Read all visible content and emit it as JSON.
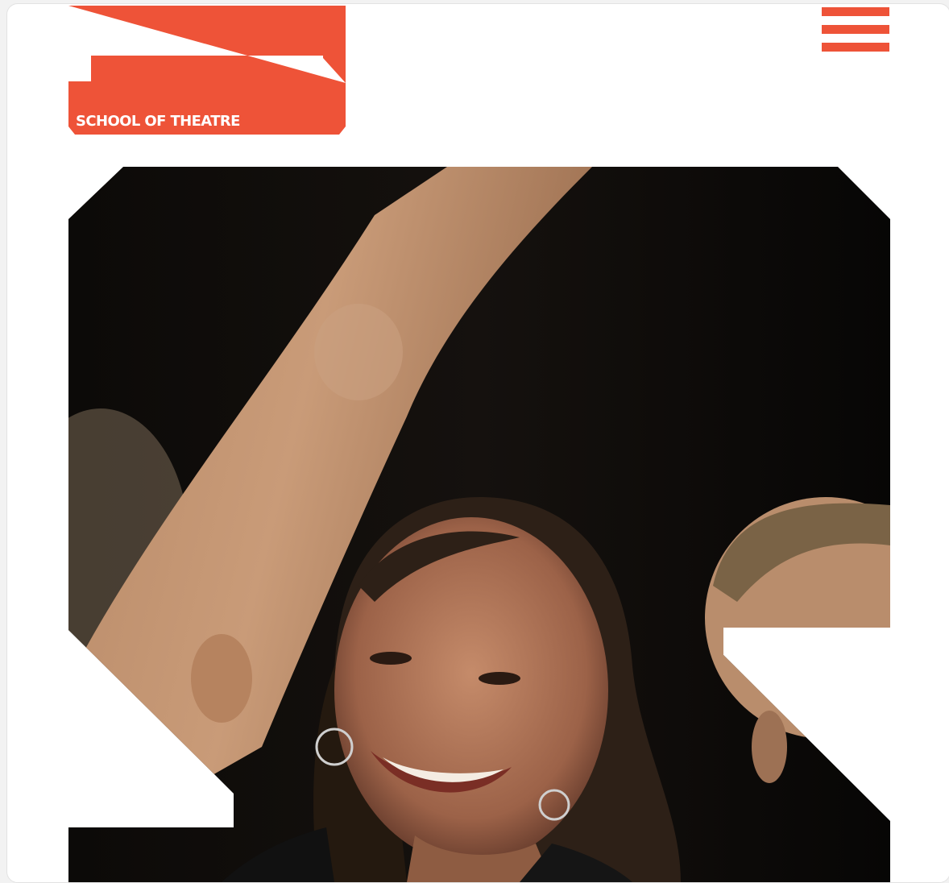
{
  "header": {
    "logo_text": "SCHOOL OF THEATRE",
    "menu_icon": "hamburger-icon"
  },
  "hero": {
    "image_subject": "smiling woman with hoop earrings between two performers on a dark stage"
  },
  "colors": {
    "brand": "#ee5338",
    "background": "#ffffff",
    "stage_black": "#0b0908"
  }
}
